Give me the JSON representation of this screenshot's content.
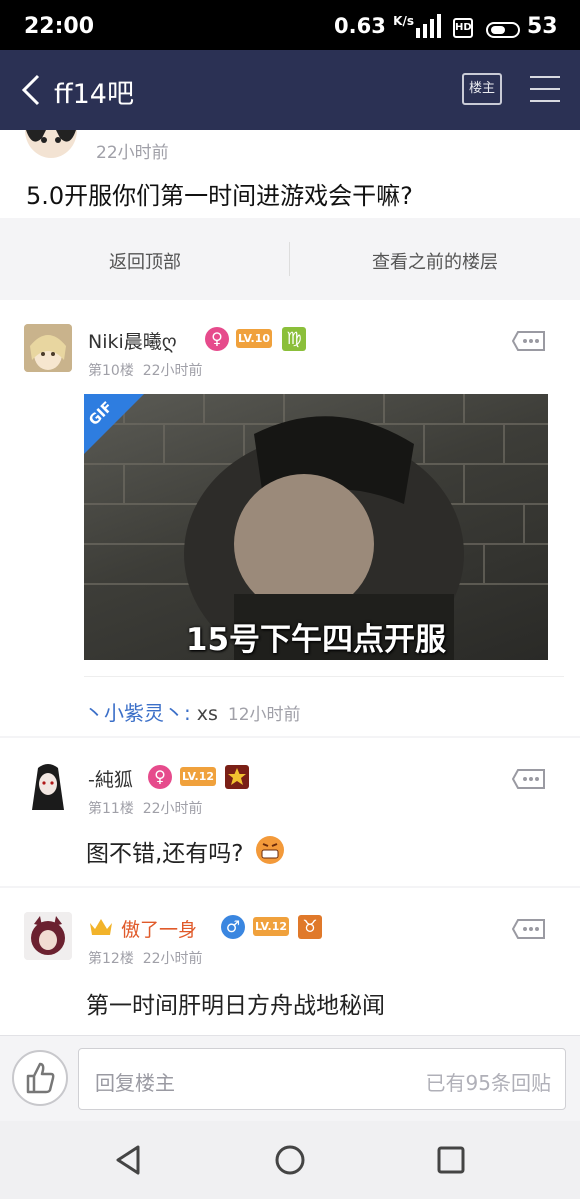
{
  "status_bar": {
    "time": "22:00",
    "speed": "0.63",
    "speed_unit": "K/s",
    "network": "4G",
    "hd": "HD",
    "battery": "53"
  },
  "header": {
    "title": "ff14吧",
    "louzhu_button": "楼主"
  },
  "op": {
    "time": "22小时前",
    "subject": "5.0开服你们第一时间进游戏会干嘛?"
  },
  "jump": {
    "back_top": "返回顶部",
    "prev_floors": "查看之前的楼层"
  },
  "posts": [
    {
      "username": "Niki晨曦ღ",
      "gender": "♀",
      "level": "LV.10",
      "zodiac": "♍",
      "floor": "第10楼",
      "time": "22小时前",
      "gif_tag": "GIF",
      "gif_caption": "15号下午四点开服",
      "reply": {
        "user": "丶小紫灵丶:",
        "text": "xs",
        "time": "12小时前"
      }
    },
    {
      "username": "-純狐",
      "gender": "♀",
      "level": "LV.12",
      "floor": "第11楼",
      "time": "22小时前",
      "content": "图不错,还有吗?"
    },
    {
      "username": "傲了一身",
      "gender": "♂",
      "level": "LV.12",
      "zodiac": "♉",
      "floor": "第12楼",
      "time": "22小时前",
      "content": "第一时间肝明日方舟战地秘闻"
    }
  ],
  "reply_bar": {
    "placeholder": "回复楼主",
    "count": "已有95条回贴"
  },
  "colors": {
    "nav_bg": "#2b3154",
    "link_blue": "#3b6fc8",
    "level_orange": "#f0a13c",
    "female_pink": "#e64b8c",
    "male_blue": "#3a86e0"
  }
}
